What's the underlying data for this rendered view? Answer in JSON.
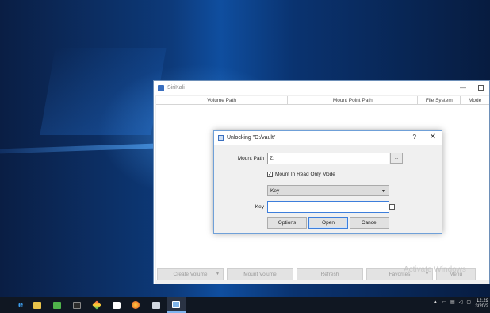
{
  "main_window": {
    "title": "SiriKali",
    "minimize": "—",
    "columns": [
      "Volume Path",
      "Mount Point Path",
      "File System",
      "Mode"
    ],
    "buttons": {
      "create_volume": "Create Volume",
      "mount_volume": "Mount Volume",
      "refresh": "Refresh",
      "favorites": "Favorites",
      "menu": "Menu"
    }
  },
  "dialog": {
    "title": "Unlocking \"D:/vault\"",
    "help": "?",
    "close": "✕",
    "mount_path_label": "Mount Path",
    "mount_path_value": "Z:",
    "browse_glyph": "...",
    "read_only_label": "Mount In Read Only Mode",
    "read_only_checked": "✓",
    "auth_type_selected": "Key",
    "key_label": "Key",
    "key_value": "",
    "buttons": {
      "options": "Options",
      "open": "Open",
      "cancel": "Cancel"
    }
  },
  "watermark": "Activate Windows",
  "taskbar": {
    "time": "12:29",
    "date": "3/20/2"
  },
  "colors": {
    "accent": "#3d7edb",
    "desktop": "#0d3a7a",
    "taskbar": "#101722"
  }
}
